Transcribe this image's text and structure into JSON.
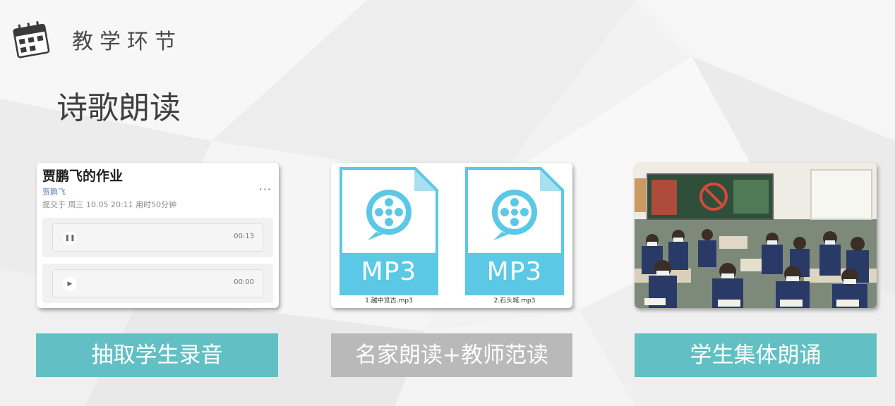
{
  "header": {
    "title": "教学环节",
    "icon": "calendar-icon"
  },
  "section": {
    "title": "诗歌朗读"
  },
  "homework_card": {
    "title": "贾鹏飞的作业",
    "author": "贾鹏飞",
    "meta": "提交于 周三 10.05 20:11 用时50分钟",
    "more": "···",
    "audios": [
      {
        "icon": "pause-icon",
        "glyph": "❚❚",
        "time": "00:13"
      },
      {
        "icon": "play-icon",
        "glyph": "▶",
        "time": "00:00"
      }
    ]
  },
  "mp3_card": {
    "files": [
      {
        "label": "MP3",
        "name": "1.越中览古.mp3",
        "icon": "film-reel-icon"
      },
      {
        "label": "MP3",
        "name": "2.石头城.mp3",
        "icon": "film-reel-icon"
      }
    ],
    "colors": {
      "file": "#5bc8e6",
      "file_fold": "#a8e0f2"
    }
  },
  "photo_card": {
    "icon": "classroom-photo"
  },
  "captions": [
    {
      "label": "抽取学生录音",
      "color": "#62c0c4"
    },
    {
      "label": "名家朗读+教师范读",
      "color": "#b9b9b9"
    },
    {
      "label": "学生集体朗诵",
      "color": "#62c0c4"
    }
  ]
}
